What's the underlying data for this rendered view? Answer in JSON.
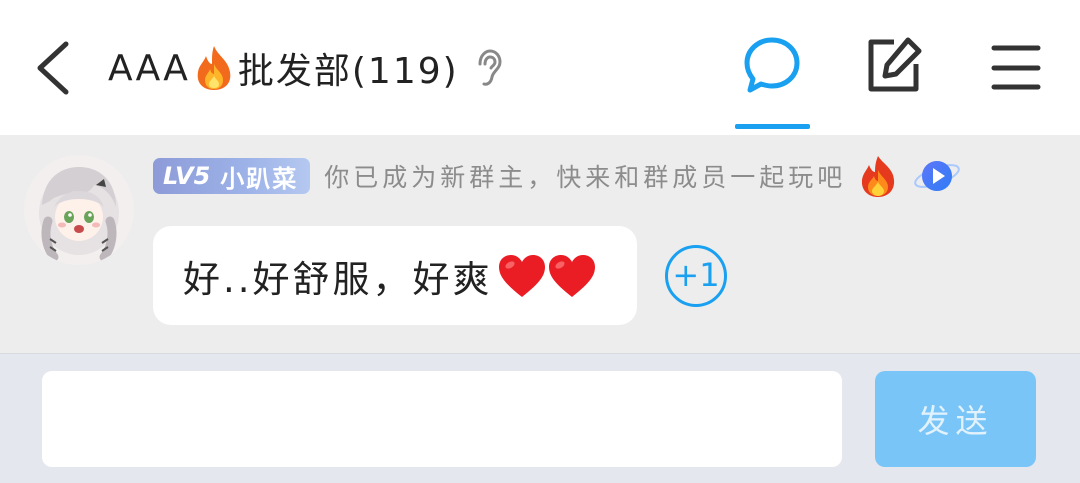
{
  "header": {
    "back_icon": "chevron-left-icon",
    "title_prefix": "AAA",
    "title_emoji_icon": "fire-icon",
    "title_name": "批发部(119)",
    "ear_icon": "ear-icon",
    "chat_icon": "chat-bubble-icon",
    "edit_icon": "edit-icon",
    "menu_icon": "menu-icon",
    "accent_color": "#1aa0f0"
  },
  "message": {
    "level_badge": {
      "level": "LV5",
      "title": "小趴菜",
      "colors": [
        "#8d9bd8",
        "#b5c8f0"
      ]
    },
    "notice": "你已成为新群主，快来和群成员一起玩吧",
    "notice_icons": [
      "fire-icon",
      "play-icon"
    ],
    "text": "好..好舒服，好爽",
    "emoji": [
      "heart-icon",
      "heart-icon"
    ],
    "plus_one": "+1"
  },
  "input_bar": {
    "input_value": "",
    "send_label": "发送",
    "send_color": "#79c5f7"
  }
}
